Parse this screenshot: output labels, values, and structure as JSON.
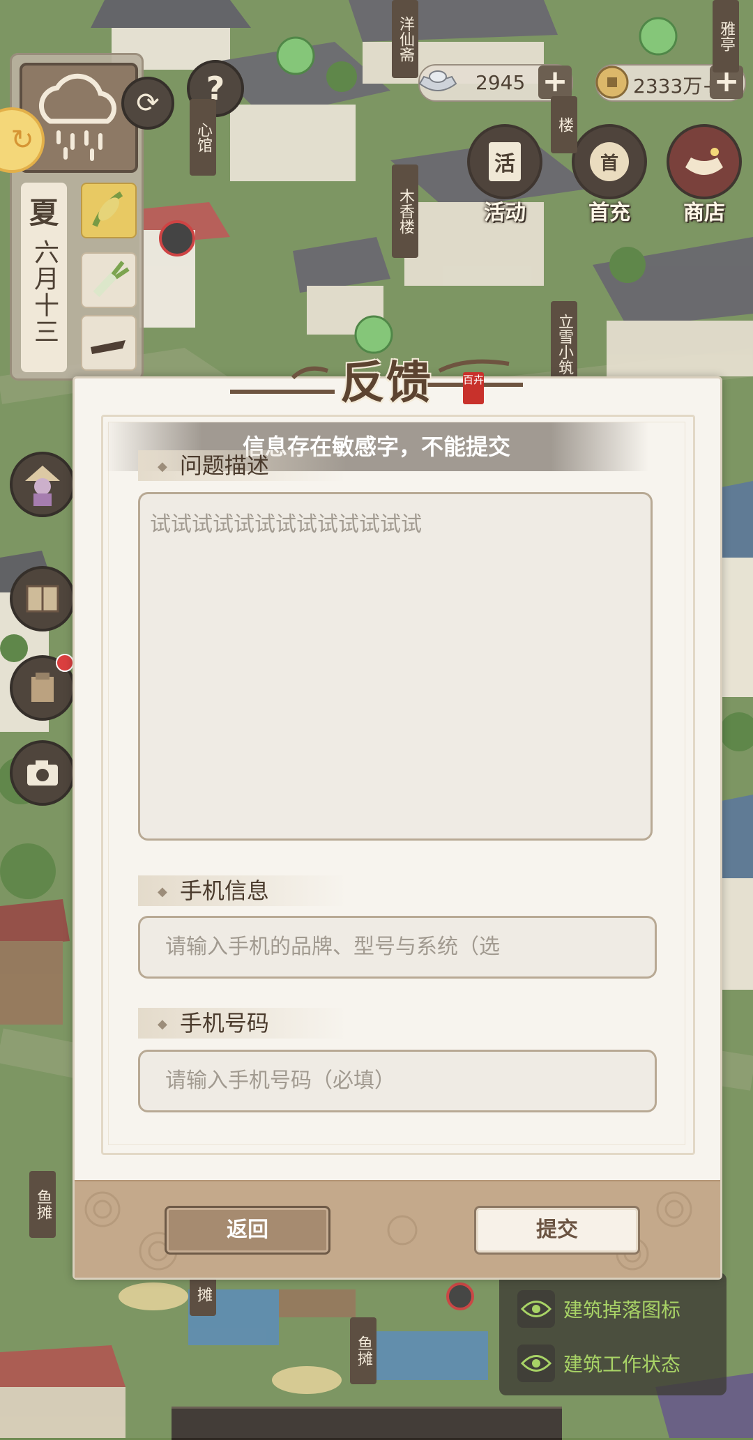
{
  "hud": {
    "season": "夏",
    "date": "六月十三",
    "silver": "2945",
    "coins": "2333万+"
  },
  "top_icons": [
    {
      "label": "活动",
      "glyph": "活"
    },
    {
      "label": "首充",
      "glyph": "首"
    },
    {
      "label": "商店",
      "glyph": ""
    }
  ],
  "map_labels": {
    "shop1": "木香楼",
    "shop2": "立雪小筑",
    "shop3": "心馆",
    "shop4": "洋仙斋",
    "shop5": "楼",
    "shop6": "雅亭",
    "fish1": "鱼摊",
    "fish2": "鱼摊",
    "stall": "摊"
  },
  "legend": {
    "row1": "建筑掉落图标",
    "row2": "建筑工作状态"
  },
  "dialog": {
    "title": "反馈",
    "seal": "百卉",
    "toast": "信息存在敏感字，不能提交",
    "problem_label": "问题描述",
    "problem_value": "试试试试试试试试试试试试试",
    "phone_info_label": "手机信息",
    "phone_info_placeholder": "请输入手机的品牌、型号与系统（选",
    "phone_number_label": "手机号码",
    "phone_number_placeholder": "请输入手机号码（必填）",
    "back_label": "返回",
    "submit_label": "提交"
  },
  "colors": {
    "dialog_bg": "#f7f4ee",
    "footer_bg": "#c4a98b",
    "legend_text": "#9fcf55",
    "grass": "#6f8b52"
  }
}
